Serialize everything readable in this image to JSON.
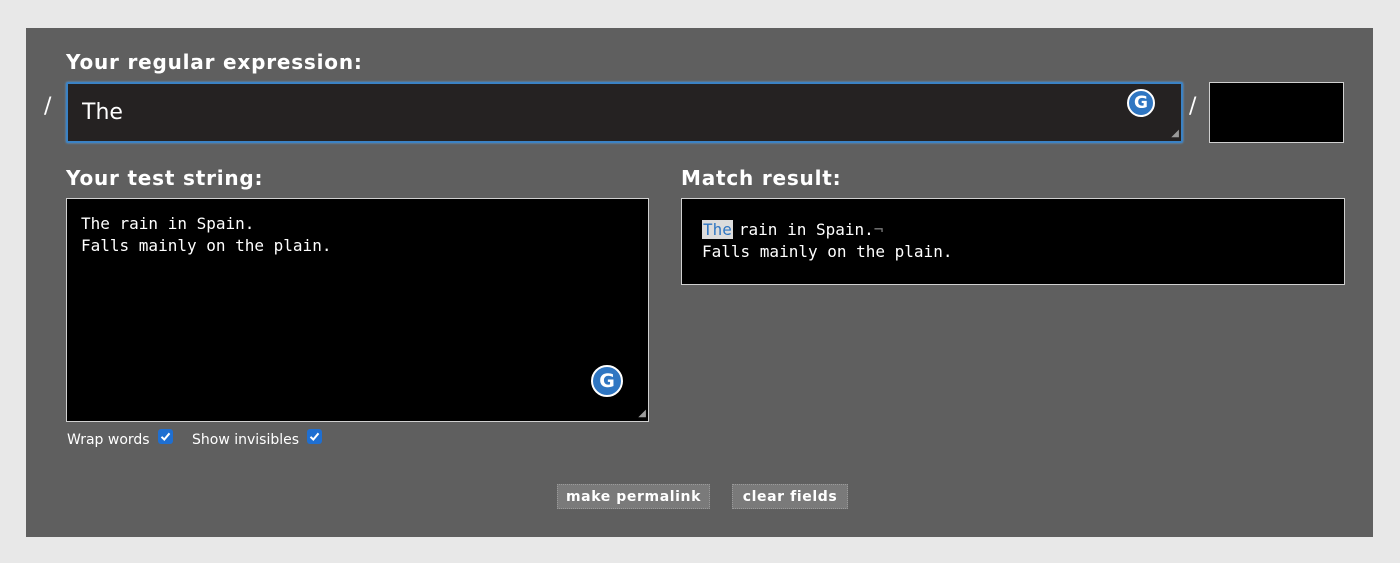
{
  "regex": {
    "label": "Your regular expression:",
    "value": "The",
    "open_slash": "/",
    "close_slash": "/",
    "flags": ""
  },
  "test": {
    "label": "Your test string:",
    "lines": [
      "The rain in Spain.",
      "Falls mainly on the plain."
    ]
  },
  "result": {
    "label": "Match result:",
    "match": "The",
    "line1_rest": "rain in Spain.",
    "eol_marker": "¬",
    "line2": "Falls mainly on the plain."
  },
  "options": {
    "wrap_words": {
      "label": "Wrap words",
      "checked": true
    },
    "show_invisibles": {
      "label": "Show invisibles",
      "checked": true
    }
  },
  "buttons": {
    "permalink": "make permalink",
    "clear": "clear fields"
  },
  "icons": {
    "grammarly": "G"
  },
  "colors": {
    "accent": "#2f76c2",
    "panel": "#5f5f5f",
    "checkbox": "#1f6fd1"
  }
}
